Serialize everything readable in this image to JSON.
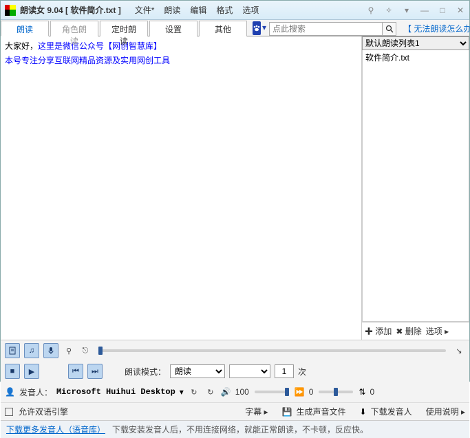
{
  "titlebar": {
    "title": "朗读女 9.04  [ 软件简介.txt ]"
  },
  "menu": {
    "file": "文件*",
    "read": "朗读",
    "edit": "编辑",
    "format": "格式",
    "options": "选项"
  },
  "tabs": {
    "read": "朗读",
    "role": "角色朗读",
    "timed": "定时朗读",
    "settings": "设置",
    "other": "其他"
  },
  "search": {
    "placeholder": "点此搜索"
  },
  "help_link": "【 无法朗读怎么办 】",
  "content": {
    "line1a": "大家好，",
    "line1b": "这里是微信公众号【网创智慧库】",
    "line2": "本号专注分享互联网精品资源及实用网创工具"
  },
  "side": {
    "list_name": "默认朗读列表1",
    "file1": "软件简介.txt",
    "add": "添加",
    "del": "删除",
    "opt": "选项"
  },
  "ctrl": {
    "mode_label": "朗读模式：",
    "mode_value": "朗读",
    "repeat_value": "1",
    "repeat_unit": "次",
    "speaker_label": "发音人：",
    "speaker_value": "Microsoft Huihui Desktop",
    "vol": "100",
    "speed": "0",
    "pitch": "0",
    "bilingual": "允许双语引擎",
    "subtitle": "字幕",
    "gen_audio": "生成声音文件",
    "dl_speaker": "下载发音人",
    "manual": "使用说明"
  },
  "footer": {
    "more": "下载更多发音人（语音库）",
    "note": "下载安装发音人后，不用连接网络，就能正常朗读，不卡顿，反应快。"
  }
}
